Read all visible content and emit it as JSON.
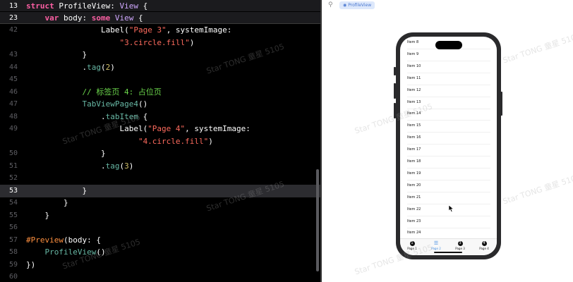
{
  "editor": {
    "sticky": [
      {
        "ln": "13",
        "tokens": [
          [
            "kw",
            "struct "
          ],
          [
            "pl",
            "ProfileView: "
          ],
          [
            "ty",
            "View"
          ],
          [
            "pl",
            " {"
          ]
        ]
      },
      {
        "ln": "23",
        "tokens": [
          [
            "pl",
            "    "
          ],
          [
            "kw",
            "var "
          ],
          [
            "pl",
            "body: "
          ],
          [
            "kw",
            "some "
          ],
          [
            "ty",
            "View"
          ],
          [
            "pl",
            " {"
          ]
        ]
      }
    ],
    "lines": [
      {
        "ln": "42",
        "tokens": [
          [
            "pl",
            "                Label("
          ],
          [
            "str",
            "\"Page 3\""
          ],
          [
            "pl",
            ", systemImage:"
          ]
        ]
      },
      {
        "ln": "",
        "tokens": [
          [
            "str",
            "                    \"3.circle.fill\""
          ],
          [
            "pl",
            ")"
          ]
        ]
      },
      {
        "ln": "43",
        "tokens": [
          [
            "pl",
            "            }"
          ]
        ]
      },
      {
        "ln": "44",
        "tokens": [
          [
            "pl",
            "            ."
          ],
          [
            "fn",
            "tag"
          ],
          [
            "pl",
            "("
          ],
          [
            "num",
            "2"
          ],
          [
            "pl",
            ")"
          ]
        ]
      },
      {
        "ln": "45",
        "tokens": [
          [
            "pl",
            ""
          ]
        ]
      },
      {
        "ln": "46",
        "tokens": [
          [
            "cm",
            "            // 标签页 4: 占位页"
          ]
        ]
      },
      {
        "ln": "47",
        "tokens": [
          [
            "fn",
            "            TabViewPage4"
          ],
          [
            "pl",
            "()"
          ]
        ]
      },
      {
        "ln": "48",
        "tokens": [
          [
            "pl",
            "                ."
          ],
          [
            "fn",
            "tabItem"
          ],
          [
            "pl",
            " {"
          ]
        ]
      },
      {
        "ln": "49",
        "tokens": [
          [
            "pl",
            "                    Label("
          ],
          [
            "str",
            "\"Page 4\""
          ],
          [
            "pl",
            ", systemImage:"
          ]
        ]
      },
      {
        "ln": "",
        "tokens": [
          [
            "str",
            "                        \"4.circle.fill\""
          ],
          [
            "pl",
            ")"
          ]
        ]
      },
      {
        "ln": "50",
        "tokens": [
          [
            "pl",
            "                }"
          ]
        ]
      },
      {
        "ln": "51",
        "tokens": [
          [
            "pl",
            "                ."
          ],
          [
            "fn",
            "tag"
          ],
          [
            "pl",
            "("
          ],
          [
            "num",
            "3"
          ],
          [
            "pl",
            ")"
          ]
        ]
      },
      {
        "ln": "52",
        "tokens": [
          [
            "pl",
            ""
          ]
        ]
      },
      {
        "ln": "53",
        "tokens": [
          [
            "pl",
            "            }"
          ]
        ],
        "current": true
      },
      {
        "ln": "54",
        "tokens": [
          [
            "pl",
            "        }"
          ]
        ]
      },
      {
        "ln": "55",
        "tokens": [
          [
            "pl",
            "    }"
          ]
        ]
      },
      {
        "ln": "56",
        "tokens": [
          [
            "pl",
            ""
          ]
        ]
      },
      {
        "ln": "57",
        "tokens": [
          [
            "pv",
            "#Preview"
          ],
          [
            "pl",
            "(body: {"
          ]
        ]
      },
      {
        "ln": "58",
        "tokens": [
          [
            "fn",
            "    ProfileView"
          ],
          [
            "pl",
            "()"
          ]
        ]
      },
      {
        "ln": "59",
        "tokens": [
          [
            "pl",
            "})"
          ]
        ]
      },
      {
        "ln": "60",
        "tokens": [
          [
            "pl",
            ""
          ]
        ]
      }
    ]
  },
  "canvas": {
    "preview_tab_label": "ProfileView",
    "list_items": [
      "Item 8",
      "Item 9",
      "Item 10",
      "Item 11",
      "Item 12",
      "Item 13",
      "Item 14",
      "Item 15",
      "Item 16",
      "Item 17",
      "Item 18",
      "Item 19",
      "Item 20",
      "Item 21",
      "Item 22",
      "Item 23",
      "Item 24"
    ],
    "tabs": [
      {
        "label": "Page 1",
        "icon": "1"
      },
      {
        "label": "Page 2",
        "icon": "☰",
        "active": true
      },
      {
        "label": "Page 3",
        "icon": "3"
      },
      {
        "label": "Page 4",
        "icon": "4"
      }
    ]
  },
  "watermark": "Star TONG 童星 5105",
  "colors": {
    "keyword": "#fc5fa3",
    "type": "#d0a8ff",
    "function": "#67b7a4",
    "string": "#fc6a5d",
    "number": "#d0bf69",
    "comment": "#6bd64b",
    "preview_macro": "#fd8f3f",
    "tab_active": "#4a90e2"
  }
}
